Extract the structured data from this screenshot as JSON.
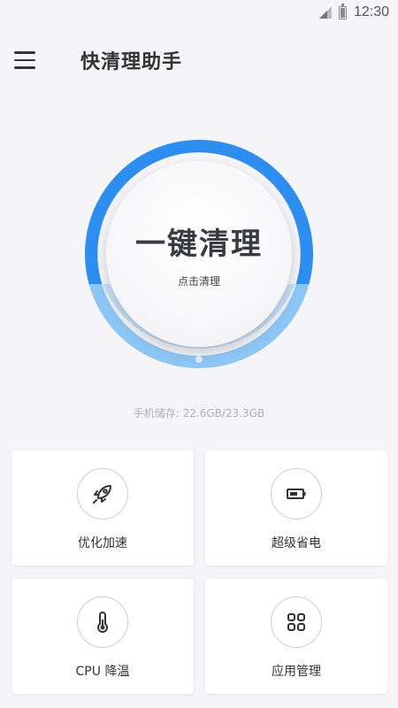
{
  "status_bar": {
    "time": "12:30",
    "signal_icon": "signal-icon",
    "battery_icon": "battery-icon"
  },
  "app_bar": {
    "title": "快清理助手",
    "menu_icon": "hamburger-menu-icon"
  },
  "clean": {
    "main_label": "一键清理",
    "sub_label": "点击清理",
    "ring_color": "#2b8ef0",
    "ring_light_color": "#8cc6f5"
  },
  "storage": {
    "text": "手机储存: 22.6GB/23.3GB"
  },
  "features": [
    {
      "label": "优化加速",
      "icon": "rocket-icon"
    },
    {
      "label": "超级省电",
      "icon": "battery-icon"
    },
    {
      "label": "CPU 降温",
      "icon": "thermometer-icon"
    },
    {
      "label": "应用管理",
      "icon": "apps-grid-icon"
    }
  ]
}
